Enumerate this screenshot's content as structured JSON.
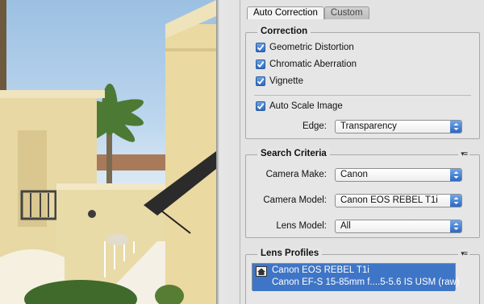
{
  "tabs": [
    {
      "label": "Auto Correction",
      "active": true
    },
    {
      "label": "Custom",
      "active": false
    }
  ],
  "correction": {
    "title": "Correction",
    "checks": [
      {
        "label": "Geometric Distortion",
        "checked": true
      },
      {
        "label": "Chromatic Aberration",
        "checked": true
      },
      {
        "label": "Vignette",
        "checked": true
      }
    ],
    "auto_scale": {
      "label": "Auto Scale Image",
      "checked": true
    },
    "edge": {
      "label": "Edge:",
      "value": "Transparency"
    }
  },
  "search_criteria": {
    "title": "Search Criteria",
    "menu_icon": "panel-menu-icon",
    "fields": [
      {
        "label": "Camera Make:",
        "value": "Canon"
      },
      {
        "label": "Camera Model:",
        "value": "Canon EOS REBEL T1i"
      },
      {
        "label": "Lens Model:",
        "value": "All"
      }
    ]
  },
  "lens_profiles": {
    "title": "Lens Profiles",
    "menu_icon": "panel-menu-icon",
    "items": [
      {
        "camera": "Canon EOS REBEL T1i",
        "lens": "Canon EF-S 15-85mm f....5-5.6 IS USM (raw)",
        "selected": true
      }
    ]
  },
  "colors": {
    "accent_blue": "#3f75c6",
    "checkbox_blue": "#2c6bc4",
    "panel_bg": "#e3e3e3"
  }
}
